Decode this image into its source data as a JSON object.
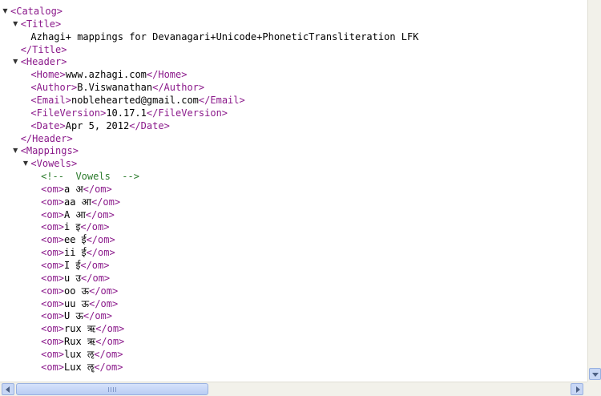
{
  "document": {
    "lines": [
      {
        "t": 1,
        "c": "<Catalog>",
        "k": "tag"
      },
      {
        "t": 2,
        "c": "<Title>",
        "k": "tag"
      },
      {
        "t": 0,
        "c": "Azhagi+ mappings for Devanagari+Unicode+PhoneticTransliteration LFK",
        "k": "text",
        "indent": 3
      },
      {
        "t": 0,
        "c": "</Title>",
        "k": "tag",
        "indent": 2
      },
      {
        "t": 2,
        "c": "<Header>",
        "k": "tag"
      },
      {
        "t": 0,
        "indent": 3,
        "parts": [
          {
            "k": "tag",
            "c": "<Home>"
          },
          {
            "k": "text",
            "c": "www.azhagi.com"
          },
          {
            "k": "tag",
            "c": "</Home>"
          }
        ]
      },
      {
        "t": 0,
        "indent": 3,
        "parts": [
          {
            "k": "tag",
            "c": "<Author>"
          },
          {
            "k": "text",
            "c": "B.Viswanathan"
          },
          {
            "k": "tag",
            "c": "</Author>"
          }
        ]
      },
      {
        "t": 0,
        "indent": 3,
        "parts": [
          {
            "k": "tag",
            "c": "<Email>"
          },
          {
            "k": "text",
            "c": "noblehearted@gmail.com"
          },
          {
            "k": "tag",
            "c": "</Email>"
          }
        ]
      },
      {
        "t": 0,
        "indent": 3,
        "parts": [
          {
            "k": "tag",
            "c": "<FileVersion>"
          },
          {
            "k": "text",
            "c": "10.17.1"
          },
          {
            "k": "tag",
            "c": "</FileVersion>"
          }
        ]
      },
      {
        "t": 0,
        "indent": 3,
        "parts": [
          {
            "k": "tag",
            "c": "<Date>"
          },
          {
            "k": "text",
            "c": "Apr 5, 2012"
          },
          {
            "k": "tag",
            "c": "</Date>"
          }
        ]
      },
      {
        "t": 0,
        "c": "</Header>",
        "k": "tag",
        "indent": 2
      },
      {
        "t": 2,
        "c": "<Mappings>",
        "k": "tag"
      },
      {
        "t": 3,
        "c": "<Vowels>",
        "k": "tag"
      },
      {
        "t": 0,
        "c": "<!--  Vowels  -->",
        "k": "comment",
        "indent": 4
      },
      {
        "t": 0,
        "indent": 4,
        "parts": [
          {
            "k": "tag",
            "c": "<om>"
          },
          {
            "k": "text",
            "c": "a अ"
          },
          {
            "k": "tag",
            "c": "</om>"
          }
        ]
      },
      {
        "t": 0,
        "indent": 4,
        "parts": [
          {
            "k": "tag",
            "c": "<om>"
          },
          {
            "k": "text",
            "c": "aa आ"
          },
          {
            "k": "tag",
            "c": "</om>"
          }
        ]
      },
      {
        "t": 0,
        "indent": 4,
        "parts": [
          {
            "k": "tag",
            "c": "<om>"
          },
          {
            "k": "text",
            "c": "A आ"
          },
          {
            "k": "tag",
            "c": "</om>"
          }
        ]
      },
      {
        "t": 0,
        "indent": 4,
        "parts": [
          {
            "k": "tag",
            "c": "<om>"
          },
          {
            "k": "text",
            "c": "i इ"
          },
          {
            "k": "tag",
            "c": "</om>"
          }
        ]
      },
      {
        "t": 0,
        "indent": 4,
        "parts": [
          {
            "k": "tag",
            "c": "<om>"
          },
          {
            "k": "text",
            "c": "ee ई"
          },
          {
            "k": "tag",
            "c": "</om>"
          }
        ]
      },
      {
        "t": 0,
        "indent": 4,
        "parts": [
          {
            "k": "tag",
            "c": "<om>"
          },
          {
            "k": "text",
            "c": "ii ई"
          },
          {
            "k": "tag",
            "c": "</om>"
          }
        ]
      },
      {
        "t": 0,
        "indent": 4,
        "parts": [
          {
            "k": "tag",
            "c": "<om>"
          },
          {
            "k": "text",
            "c": "I ई"
          },
          {
            "k": "tag",
            "c": "</om>"
          }
        ]
      },
      {
        "t": 0,
        "indent": 4,
        "parts": [
          {
            "k": "tag",
            "c": "<om>"
          },
          {
            "k": "text",
            "c": "u उ"
          },
          {
            "k": "tag",
            "c": "</om>"
          }
        ]
      },
      {
        "t": 0,
        "indent": 4,
        "parts": [
          {
            "k": "tag",
            "c": "<om>"
          },
          {
            "k": "text",
            "c": "oo ऊ"
          },
          {
            "k": "tag",
            "c": "</om>"
          }
        ]
      },
      {
        "t": 0,
        "indent": 4,
        "parts": [
          {
            "k": "tag",
            "c": "<om>"
          },
          {
            "k": "text",
            "c": "uu ऊ"
          },
          {
            "k": "tag",
            "c": "</om>"
          }
        ]
      },
      {
        "t": 0,
        "indent": 4,
        "parts": [
          {
            "k": "tag",
            "c": "<om>"
          },
          {
            "k": "text",
            "c": "U ऊ"
          },
          {
            "k": "tag",
            "c": "</om>"
          }
        ]
      },
      {
        "t": 0,
        "indent": 4,
        "parts": [
          {
            "k": "tag",
            "c": "<om>"
          },
          {
            "k": "text",
            "c": "rux ऋ"
          },
          {
            "k": "tag",
            "c": "</om>"
          }
        ]
      },
      {
        "t": 0,
        "indent": 4,
        "parts": [
          {
            "k": "tag",
            "c": "<om>"
          },
          {
            "k": "text",
            "c": "Rux ऋ"
          },
          {
            "k": "tag",
            "c": "</om>"
          }
        ]
      },
      {
        "t": 0,
        "indent": 4,
        "parts": [
          {
            "k": "tag",
            "c": "<om>"
          },
          {
            "k": "text",
            "c": "lux ऌ"
          },
          {
            "k": "tag",
            "c": "</om>"
          }
        ]
      },
      {
        "t": 0,
        "indent": 4,
        "parts": [
          {
            "k": "tag",
            "c": "<om>"
          },
          {
            "k": "text",
            "c": "Lux ॡ"
          },
          {
            "k": "tag",
            "c": "</om>"
          }
        ]
      }
    ]
  },
  "icons": {
    "expanded": "triangle-down-icon",
    "scroll_up": "arrow-up-icon",
    "scroll_down": "arrow-down-icon",
    "scroll_left": "arrow-left-icon",
    "scroll_right": "arrow-right-icon"
  },
  "colors": {
    "tag": "#8b1a8b",
    "comment": "#2a7a2a",
    "text": "#000000",
    "scroll_button": "#c8d7f5"
  }
}
